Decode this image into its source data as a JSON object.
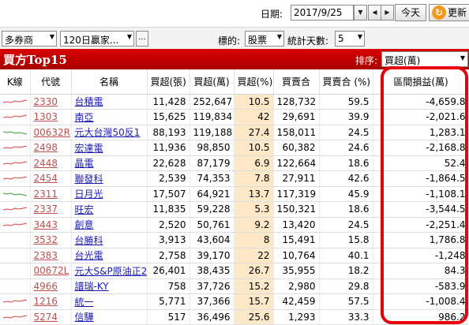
{
  "topbar": {
    "date_label": "日期:",
    "date_value": "2017/9/25",
    "today_label": "今天",
    "refresh_label": "更新"
  },
  "filters": {
    "broker_value": "多券商",
    "period_value": "120日贏家...",
    "more_label": "...",
    "target_label": "標的:",
    "target_value": "股票",
    "days_label": "統計天數:",
    "days_value": "5"
  },
  "panel": {
    "title": "買方Top15",
    "sort_label": "排序:",
    "sort_value": "買超(萬)"
  },
  "table": {
    "headers": [
      "K線",
      "代號",
      "名稱",
      "買超(張)",
      "買超(萬)",
      "買超(%)",
      "買賣合",
      "買賣合 (%)",
      "區間損益(萬)"
    ],
    "rows": [
      {
        "code": "2330",
        "name": "台積電",
        "buy_lots": "11,428",
        "buy_amt": "252,647",
        "buy_pct": "10.5",
        "total": "128,732",
        "total_pct": "59.5",
        "pnl": "-4,659.8",
        "spark": "red"
      },
      {
        "code": "1303",
        "name": "南亞",
        "buy_lots": "15,625",
        "buy_amt": "119,834",
        "buy_pct": "42",
        "total": "29,691",
        "total_pct": "39.9",
        "pnl": "-2,021.6",
        "spark": "red"
      },
      {
        "code": "00632R",
        "name": "元大台灣50反1",
        "buy_lots": "88,193",
        "buy_amt": "119,188",
        "buy_pct": "27.4",
        "total": "158,011",
        "total_pct": "24.5",
        "pnl": "1,283.1",
        "spark": "green"
      },
      {
        "code": "2498",
        "name": "宏達電",
        "buy_lots": "11,936",
        "buy_amt": "98,850",
        "buy_pct": "10.5",
        "total": "60,382",
        "total_pct": "24.6",
        "pnl": "-2,168.8",
        "spark": "red"
      },
      {
        "code": "2448",
        "name": "晶電",
        "buy_lots": "22,628",
        "buy_amt": "87,179",
        "buy_pct": "6.9",
        "total": "122,664",
        "total_pct": "18.6",
        "pnl": "52.4",
        "spark": "red"
      },
      {
        "code": "2454",
        "name": "聯發科",
        "buy_lots": "2,539",
        "buy_amt": "74,353",
        "buy_pct": "7.8",
        "total": "27,911",
        "total_pct": "42.6",
        "pnl": "-1,864.5",
        "spark": "red"
      },
      {
        "code": "2311",
        "name": "日月光",
        "buy_lots": "17,507",
        "buy_amt": "64,921",
        "buy_pct": "13.7",
        "total": "117,319",
        "total_pct": "45.9",
        "pnl": "-1,108.1",
        "spark": "green"
      },
      {
        "code": "2337",
        "name": "旺宏",
        "buy_lots": "11,835",
        "buy_amt": "59,228",
        "buy_pct": "5.3",
        "total": "150,321",
        "total_pct": "18.6",
        "pnl": "-3,544.5",
        "spark": "red"
      },
      {
        "code": "3443",
        "name": "創意",
        "buy_lots": "2,520",
        "buy_amt": "50,761",
        "buy_pct": "9.2",
        "total": "13,420",
        "total_pct": "24.5",
        "pnl": "-2,251.4",
        "spark": "red"
      },
      {
        "code": "3532",
        "name": "台勝科",
        "buy_lots": "3,913",
        "buy_amt": "43,604",
        "buy_pct": "8",
        "total": "15,491",
        "total_pct": "15.8",
        "pnl": "1,786.8",
        "spark": "none"
      },
      {
        "code": "2383",
        "name": "台光電",
        "buy_lots": "2,758",
        "buy_amt": "39,170",
        "buy_pct": "22",
        "total": "10,764",
        "total_pct": "40.1",
        "pnl": "-1,248",
        "spark": "none"
      },
      {
        "code": "00672L",
        "name": "元大S&P原油正2",
        "buy_lots": "26,401",
        "buy_amt": "38,435",
        "buy_pct": "26.7",
        "total": "35,955",
        "total_pct": "18.2",
        "pnl": "84.3",
        "spark": "none"
      },
      {
        "code": "4966",
        "name": "譜瑞-KY",
        "buy_lots": "758",
        "buy_amt": "37,726",
        "buy_pct": "15.2",
        "total": "2,980",
        "total_pct": "29.8",
        "pnl": "-583.9",
        "spark": "none"
      },
      {
        "code": "1216",
        "name": "統一",
        "buy_lots": "5,771",
        "buy_amt": "37,366",
        "buy_pct": "15.7",
        "total": "42,459",
        "total_pct": "57.5",
        "pnl": "-1,008.4",
        "spark": "red"
      },
      {
        "code": "5274",
        "name": "信驊",
        "buy_lots": "517",
        "buy_amt": "36,496",
        "buy_pct": "25.6",
        "total": "1,293",
        "total_pct": "33.3",
        "pnl": "986.2",
        "spark": "red"
      }
    ]
  },
  "colors": {
    "title_bg": "#cc0000",
    "code_link": "#c0504d",
    "name_link": "#1a1ab3",
    "pct_bg": "#fde8c8",
    "highlight": "#e8000b",
    "spark_red": "#d84040",
    "spark_green": "#2e9e2e"
  },
  "icons": {
    "refresh": "refresh-icon",
    "prev": "triangle-left-icon",
    "next": "triangle-right-icon",
    "dropdown": "chevron-down-icon"
  }
}
